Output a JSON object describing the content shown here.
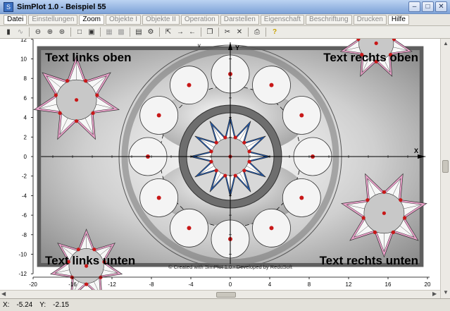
{
  "window": {
    "title": "SimPlot 1.0 - Beispiel 55"
  },
  "menu": {
    "tabs": [
      "Datei",
      "Einstellungen",
      "Zoom",
      "Objekte I",
      "Objekte II",
      "Operation",
      "Darstellen",
      "Eigenschaft",
      "Beschriftung",
      "Drucken",
      "Hilfe"
    ],
    "active": [
      0,
      2,
      10
    ]
  },
  "toolbar": {
    "icons": [
      "device-icon",
      "formula-icon",
      "zoom-out-icon",
      "zoom-in-icon",
      "zoom-fit-icon",
      "square-icon",
      "frame-icon",
      "frame2-icon",
      "frame3-icon",
      "table-icon",
      "settings-icon",
      "resize-icon",
      "arrow-right-icon",
      "arrow-left-icon",
      "copy-icon",
      "cut-icon",
      "delete-icon",
      "print-icon",
      "help-icon"
    ]
  },
  "plot": {
    "corner_texts": {
      "top_left": "Text links oben",
      "top_right": "Text rechts oben",
      "bottom_left": "Text links unten",
      "bottom_right": "Text rechts unten"
    },
    "credit": "© Created with SimPlot 1.0 - Developed by ReduSoft",
    "axis_x_label": "X",
    "axis_y_label": "Y",
    "x_ticks": [
      "-20",
      "-16",
      "-12",
      "-8",
      "-4",
      "0",
      "4",
      "8",
      "12",
      "16",
      "20"
    ],
    "y_ticks": [
      "12",
      "10",
      "8",
      "6",
      "4",
      "2",
      "0",
      "-2",
      "-4",
      "-6",
      "-8",
      "-10",
      "-12"
    ],
    "xlim": [
      -20,
      20
    ],
    "ylim": [
      -12,
      12
    ]
  },
  "status": {
    "x_label": "X:",
    "x_value": "-5.24",
    "y_label": "Y:",
    "y_value": "-2.15"
  },
  "colors": {
    "accent": "#1e5bb8",
    "star_pink": "#e8a0c8",
    "point_red": "#c81818"
  }
}
